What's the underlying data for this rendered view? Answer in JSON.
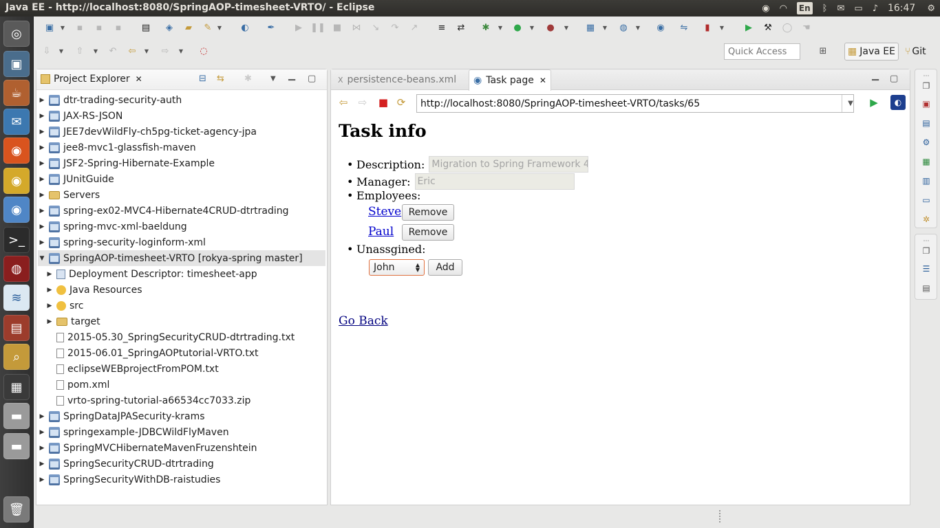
{
  "window": {
    "title": "Java EE - http://localhost:8080/SpringAOP-timesheet-VRTO/ - Eclipse",
    "lang": "En",
    "clock": "16:47"
  },
  "toolbar": {
    "quick_access_placeholder": "Quick Access",
    "perspective_javaee": "Java EE",
    "perspective_git": "Git"
  },
  "explorer": {
    "title": "Project Explorer",
    "items": [
      {
        "label": "dtr-trading-security-auth",
        "icon": "project",
        "level": 0,
        "expanded": false
      },
      {
        "label": "JAX-RS-JSON",
        "icon": "project",
        "level": 0,
        "expanded": false
      },
      {
        "label": "JEE7devWildFly-ch5pg-ticket-agency-jpa",
        "icon": "project",
        "level": 0,
        "expanded": false
      },
      {
        "label": "jee8-mvc1-glassfish-maven",
        "icon": "project",
        "level": 0,
        "expanded": false
      },
      {
        "label": "JSF2-Spring-Hibernate-Example",
        "icon": "project",
        "level": 0,
        "expanded": false
      },
      {
        "label": "JUnitGuide",
        "icon": "project",
        "level": 0,
        "expanded": false
      },
      {
        "label": "Servers",
        "icon": "folder",
        "level": 0,
        "expanded": false
      },
      {
        "label": "spring-ex02-MVC4-Hibernate4CRUD-dtrtrading",
        "icon": "project",
        "level": 0,
        "expanded": false
      },
      {
        "label": "spring-mvc-xml-baeldung",
        "icon": "project",
        "level": 0,
        "expanded": false
      },
      {
        "label": "spring-security-loginform-xml",
        "icon": "project",
        "level": 0,
        "expanded": false
      },
      {
        "label": "SpringAOP-timesheet-VRTO  [rokya-spring master]",
        "icon": "project",
        "level": 0,
        "expanded": true,
        "selected": true
      },
      {
        "label": "Deployment Descriptor: timesheet-app",
        "icon": "descriptor",
        "level": 1,
        "expanded": false
      },
      {
        "label": "Java Resources",
        "icon": "gear",
        "level": 1,
        "expanded": false
      },
      {
        "label": "src",
        "icon": "gear",
        "level": 1,
        "expanded": false
      },
      {
        "label": "target",
        "icon": "folder",
        "level": 1,
        "expanded": false
      },
      {
        "label": "2015-05.30_SpringSecurityCRUD-dtrtrading.txt",
        "icon": "file",
        "level": 1,
        "leaf": true
      },
      {
        "label": "2015-06.01_SpringAOPtutorial-VRTO.txt",
        "icon": "file",
        "level": 1,
        "leaf": true
      },
      {
        "label": "eclipseWEBprojectFromPOM.txt",
        "icon": "file",
        "level": 1,
        "leaf": true
      },
      {
        "label": "pom.xml",
        "icon": "file",
        "level": 1,
        "leaf": true
      },
      {
        "label": "vrto-spring-tutorial-a66534cc7033.zip",
        "icon": "file",
        "level": 1,
        "leaf": true
      },
      {
        "label": "SpringDataJPASecurity-krams",
        "icon": "project",
        "level": 0,
        "expanded": false
      },
      {
        "label": "springexample-JDBCWildFlyMaven",
        "icon": "project",
        "level": 0,
        "expanded": false
      },
      {
        "label": "SpringMVCHibernateMavenFruzenshtein",
        "icon": "project",
        "level": 0,
        "expanded": false
      },
      {
        "label": "SpringSecurityCRUD-dtrtrading",
        "icon": "project",
        "level": 0,
        "expanded": false
      },
      {
        "label": "SpringSecurityWithDB-raistudies",
        "icon": "project",
        "level": 0,
        "expanded": false
      }
    ]
  },
  "editor": {
    "tabs": [
      {
        "label": "persistence-beans.xml",
        "active": false
      },
      {
        "label": "Task page",
        "active": true
      }
    ],
    "url": "http://localhost:8080/SpringAOP-timesheet-VRTO/tasks/65"
  },
  "page": {
    "heading": "Task info",
    "description_label": "Description:",
    "description_value": "Migration to Spring Framework 4.",
    "manager_label": "Manager:",
    "manager_value": "Eric",
    "employees_label": "Employees:",
    "employees": [
      {
        "name": "Steve",
        "action": "Remove"
      },
      {
        "name": "Paul",
        "action": "Remove"
      }
    ],
    "unassigned_label": "Unassgined:",
    "unassigned_selected": "John",
    "add_label": "Add",
    "go_back": "Go Back"
  },
  "colors": {
    "link": "#0000cc",
    "select_border": "#e0703e",
    "selection_bg": "#e4e4e4"
  }
}
